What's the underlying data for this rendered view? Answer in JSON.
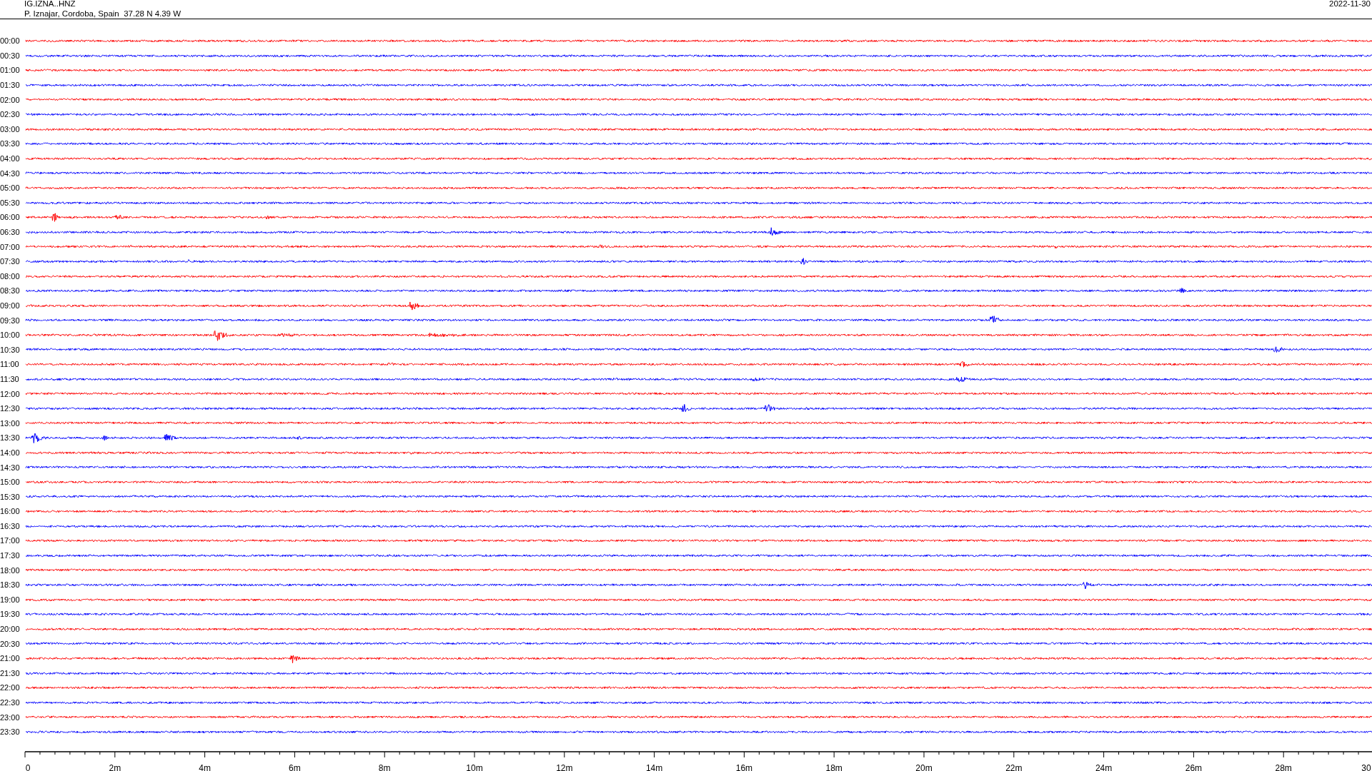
{
  "header": {
    "station": "IG.IZNA..HNZ",
    "location": "P. Iznajar, Cordoba, Spain  37.28 N 4.39 W",
    "date": "2022-11-30"
  },
  "helicorder": {
    "rows": [
      {
        "label": "00:00",
        "color": "#ff0000"
      },
      {
        "label": "00:30",
        "color": "#0000ff"
      },
      {
        "label": "01:00",
        "color": "#ff0000"
      },
      {
        "label": "01:30",
        "color": "#0000ff"
      },
      {
        "label": "02:00",
        "color": "#ff0000"
      },
      {
        "label": "02:30",
        "color": "#0000ff"
      },
      {
        "label": "03:00",
        "color": "#ff0000"
      },
      {
        "label": "03:30",
        "color": "#0000ff"
      },
      {
        "label": "04:00",
        "color": "#ff0000"
      },
      {
        "label": "04:30",
        "color": "#0000ff"
      },
      {
        "label": "05:00",
        "color": "#ff0000"
      },
      {
        "label": "05:30",
        "color": "#0000ff"
      },
      {
        "label": "06:00",
        "color": "#ff0000"
      },
      {
        "label": "06:30",
        "color": "#0000ff"
      },
      {
        "label": "07:00",
        "color": "#ff0000"
      },
      {
        "label": "07:30",
        "color": "#0000ff"
      },
      {
        "label": "08:00",
        "color": "#ff0000"
      },
      {
        "label": "08:30",
        "color": "#0000ff"
      },
      {
        "label": "09:00",
        "color": "#ff0000"
      },
      {
        "label": "09:30",
        "color": "#0000ff"
      },
      {
        "label": "10:00",
        "color": "#ff0000"
      },
      {
        "label": "10:30",
        "color": "#0000ff"
      },
      {
        "label": "11:00",
        "color": "#ff0000"
      },
      {
        "label": "11:30",
        "color": "#0000ff"
      },
      {
        "label": "12:00",
        "color": "#ff0000"
      },
      {
        "label": "12:30",
        "color": "#0000ff"
      },
      {
        "label": "13:00",
        "color": "#ff0000"
      },
      {
        "label": "13:30",
        "color": "#0000ff"
      },
      {
        "label": "14:00",
        "color": "#ff0000"
      },
      {
        "label": "14:30",
        "color": "#0000ff"
      },
      {
        "label": "15:00",
        "color": "#ff0000"
      },
      {
        "label": "15:30",
        "color": "#0000ff"
      },
      {
        "label": "16:00",
        "color": "#ff0000"
      },
      {
        "label": "16:30",
        "color": "#0000ff"
      },
      {
        "label": "17:00",
        "color": "#ff0000"
      },
      {
        "label": "17:30",
        "color": "#0000ff"
      },
      {
        "label": "18:00",
        "color": "#ff0000"
      },
      {
        "label": "18:30",
        "color": "#0000ff"
      },
      {
        "label": "19:00",
        "color": "#ff0000"
      },
      {
        "label": "19:30",
        "color": "#0000ff"
      },
      {
        "label": "20:00",
        "color": "#ff0000"
      },
      {
        "label": "20:30",
        "color": "#0000ff"
      },
      {
        "label": "21:00",
        "color": "#ff0000"
      },
      {
        "label": "21:30",
        "color": "#0000ff"
      },
      {
        "label": "22:00",
        "color": "#ff0000"
      },
      {
        "label": "22:30",
        "color": "#0000ff"
      },
      {
        "label": "23:00",
        "color": "#ff0000"
      },
      {
        "label": "23:30",
        "color": "#0000ff"
      }
    ],
    "x_axis": {
      "ticks": [
        "0",
        "2m",
        "4m",
        "6m",
        "8m",
        "10m",
        "12m",
        "14m",
        "16m",
        "18m",
        "20m",
        "22m",
        "24m",
        "26m",
        "28m",
        "30"
      ]
    }
  }
}
